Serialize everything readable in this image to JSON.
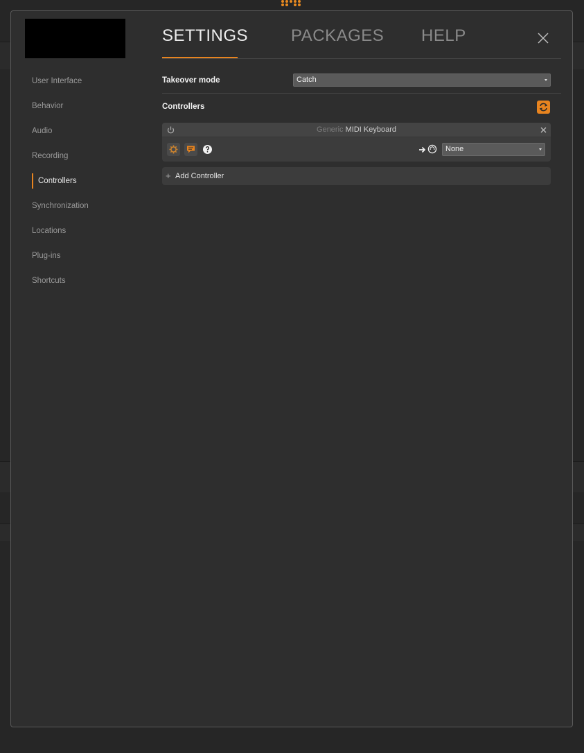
{
  "header": {
    "tabs": [
      {
        "label": "SETTINGS",
        "active": true
      },
      {
        "label": "PACKAGES",
        "active": false
      },
      {
        "label": "HELP",
        "active": false
      }
    ]
  },
  "sidebar": {
    "items": [
      {
        "label": "User Interface",
        "active": false
      },
      {
        "label": "Behavior",
        "active": false
      },
      {
        "label": "Audio",
        "active": false
      },
      {
        "label": "Recording",
        "active": false
      },
      {
        "label": "Controllers",
        "active": true
      },
      {
        "label": "Synchronization",
        "active": false
      },
      {
        "label": "Locations",
        "active": false
      },
      {
        "label": "Plug-ins",
        "active": false
      },
      {
        "label": "Shortcuts",
        "active": false
      }
    ]
  },
  "main": {
    "takeover_label": "Takeover mode",
    "takeover_value": "Catch",
    "controllers_label": "Controllers",
    "controller": {
      "vendor": "Generic",
      "name": "MIDI Keyboard",
      "output_value": "None"
    },
    "add_controller_label": "Add Controller"
  },
  "colors": {
    "accent": "#e8841f",
    "background": "#2e2e2e",
    "panel": "#3c3c3c"
  },
  "icons": [
    "close-icon",
    "refresh-icon",
    "power-icon",
    "gear-icon",
    "speech-bubble-icon",
    "help-icon",
    "arrow-right-icon",
    "midi-port-icon",
    "plus-icon",
    "chevron-down-icon"
  ]
}
